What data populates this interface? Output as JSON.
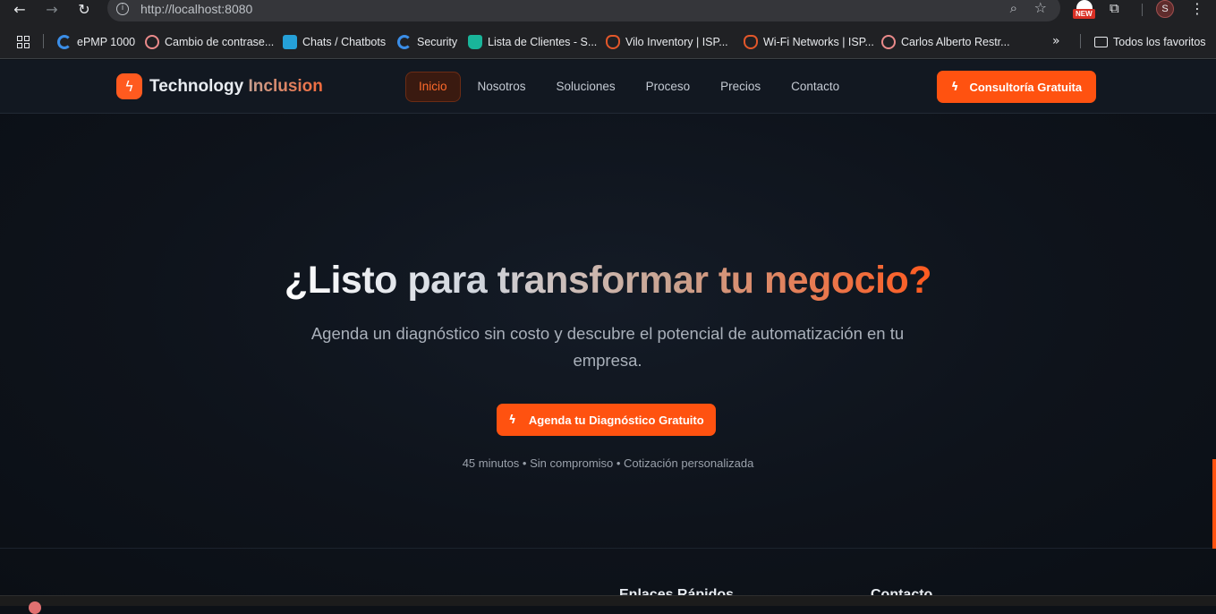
{
  "browser": {
    "url": "http://localhost:8080",
    "new_badge": "NEW",
    "profile_initial": "S",
    "bookmarks": [
      {
        "label": "ePMP 1000",
        "icon": "cambium-icon"
      },
      {
        "label": "Cambio de contrase...",
        "icon": "no-access-icon"
      },
      {
        "label": "Chats / Chatbots",
        "icon": "chat-icon"
      },
      {
        "label": "Security",
        "icon": "cambium-icon"
      },
      {
        "label": "Lista de Clientes - S...",
        "icon": "bucket-icon"
      },
      {
        "label": "Vilo Inventory | ISP...",
        "icon": "wolf-icon"
      },
      {
        "label": "Wi-Fi Networks | ISP...",
        "icon": "wolf-icon"
      },
      {
        "label": "Carlos Alberto Restr...",
        "icon": "no-access-icon"
      }
    ],
    "all_bookmarks": "Todos los favoritos"
  },
  "header": {
    "brand_main": "Technology",
    "brand_accent": "Inclusion",
    "nav": [
      "Inicio",
      "Nosotros",
      "Soluciones",
      "Proceso",
      "Precios",
      "Contacto"
    ],
    "active_nav": "Inicio",
    "cta_label": "Consultoría Gratuita"
  },
  "hero": {
    "title": "¿Listo para transformar tu negocio?",
    "subtitle": "Agenda un diagnóstico sin costo y descubre el potencial de automatización en tu empresa.",
    "cta_label": "Agenda tu Diagnóstico Gratuito",
    "note": "45 minutos • Sin compromiso • Cotización personalizada"
  },
  "footer": {
    "col_links": "Enlaces Rápidos",
    "col_contact": "Contacto"
  },
  "colors": {
    "accent": "#ff5210",
    "background": "#0d1117"
  }
}
